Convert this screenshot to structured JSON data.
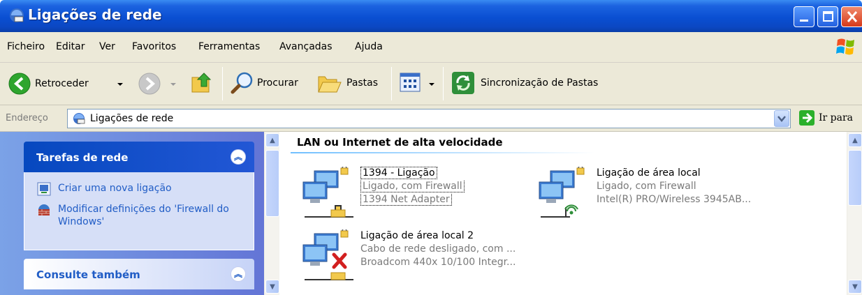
{
  "window": {
    "title": "Ligações de rede"
  },
  "menu": [
    "Ficheiro",
    "Editar",
    "Ver",
    "Favoritos",
    "Ferramentas",
    "Avançadas",
    "Ajuda"
  ],
  "toolbar": {
    "back_label": "Retroceder",
    "search_label": "Procurar",
    "folders_label": "Pastas",
    "sync_label": "Sincronização de Pastas"
  },
  "address": {
    "label": "Endereço",
    "value": "Ligações de rede",
    "go_label": "Ir para"
  },
  "left_pane": {
    "network_tasks": {
      "title": "Tarefas de rede",
      "items": [
        {
          "label": "Criar uma nova ligação"
        },
        {
          "label": "Modificar definições do 'Firewall do Windows'"
        }
      ]
    },
    "see_also": {
      "title": "Consulte também"
    }
  },
  "content": {
    "group_title": "LAN ou Internet de alta velocidade",
    "connections": [
      {
        "name": "1394 - Ligação",
        "status": "Ligado, com Firewall",
        "device": "1394 Net Adapter"
      },
      {
        "name": "Ligação de área local",
        "status": "Ligado, com Firewall",
        "device": "Intel(R) PRO/Wireless 3945AB..."
      },
      {
        "name": "Ligação de área local 2",
        "status": "Cabo de rede desligado, com ...",
        "device": "Broadcom 440x 10/100 Integr..."
      }
    ]
  },
  "colors": {
    "titlebar": "#0a4fd2",
    "task_link": "#215dc6",
    "left_pane": "#7ba2e7"
  }
}
